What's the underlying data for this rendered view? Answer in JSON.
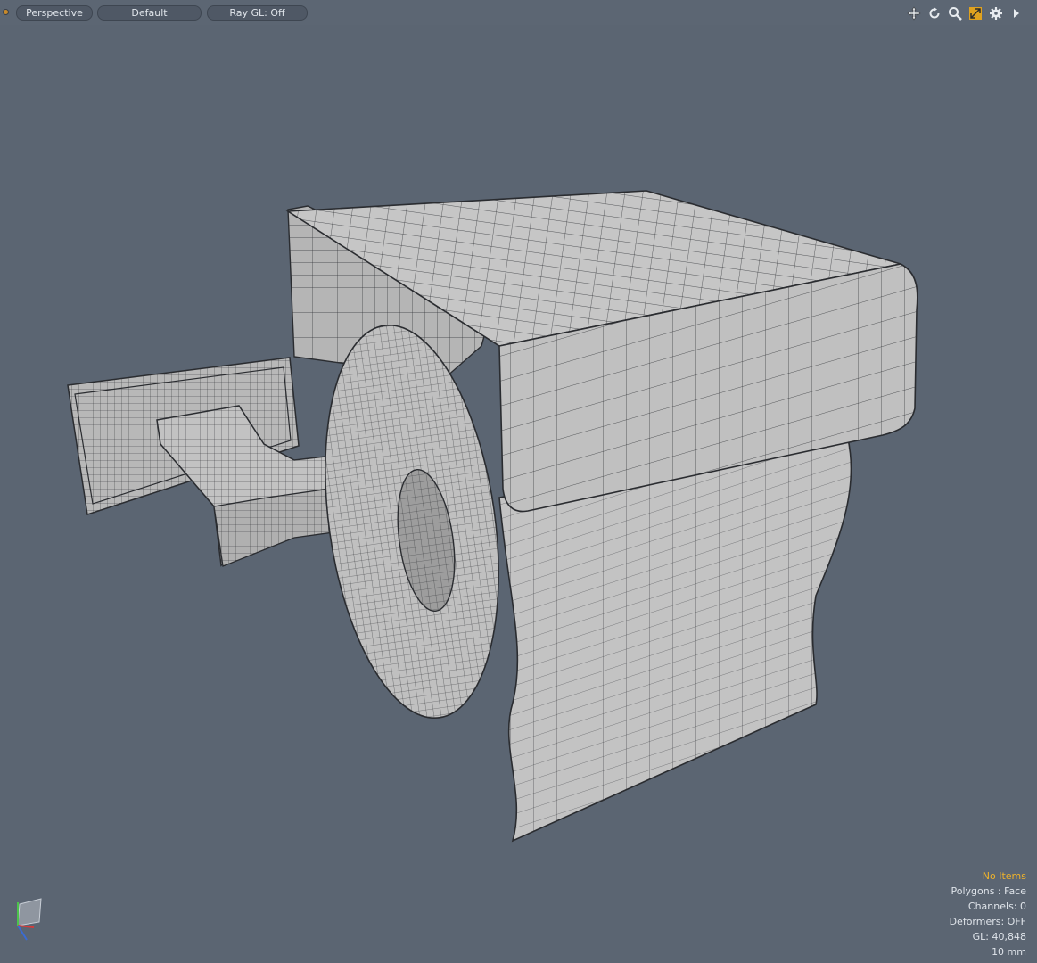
{
  "toolbar": {
    "view_mode": "Perspective",
    "shading": "Default",
    "raygl": "Ray GL: Off",
    "icons": [
      "move-view-icon",
      "rotate-view-icon",
      "zoom-view-icon",
      "fit-view-icon",
      "viewport-settings-icon",
      "expand-arrow-icon"
    ]
  },
  "status": {
    "items": "No Items",
    "polygons": "Polygons : Face",
    "channels": "Channels: 0",
    "deformers": "Deformers: OFF",
    "gl": "GL: 40,848",
    "scale": "10 mm"
  },
  "colors": {
    "background": "#5b6572",
    "mesh_surface": "#bdbdbd",
    "wire": "#2f3136",
    "status_accent": "#f0b32a"
  }
}
